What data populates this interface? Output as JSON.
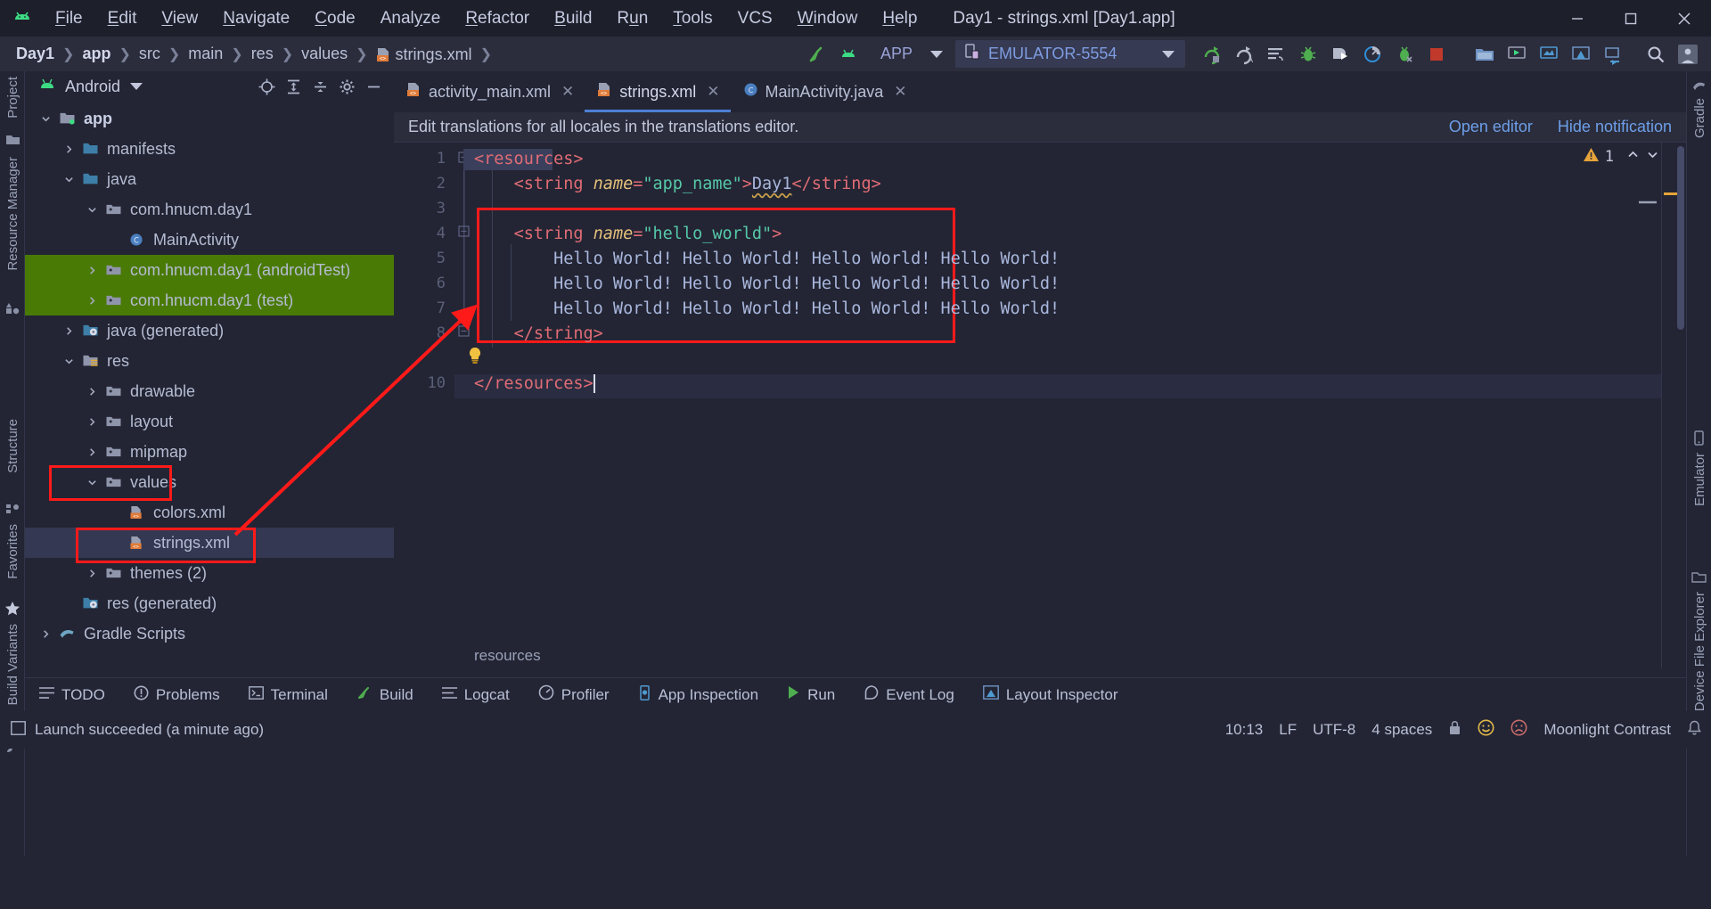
{
  "window": {
    "title": "Day1 - strings.xml [Day1.app]",
    "app_icon": "android-logo-icon",
    "minimize": "minimize-icon",
    "maximize": "maximize-icon",
    "close": "close-icon"
  },
  "menu": [
    {
      "label": "File",
      "mnemonic": "F"
    },
    {
      "label": "Edit",
      "mnemonic": "E"
    },
    {
      "label": "View",
      "mnemonic": "V"
    },
    {
      "label": "Navigate",
      "mnemonic": "N"
    },
    {
      "label": "Code",
      "mnemonic": "C"
    },
    {
      "label": "Analyze",
      "mnemonic": "y"
    },
    {
      "label": "Refactor",
      "mnemonic": "R"
    },
    {
      "label": "Build",
      "mnemonic": "B"
    },
    {
      "label": "Run",
      "mnemonic": "u"
    },
    {
      "label": "Tools",
      "mnemonic": "T"
    },
    {
      "label": "VCS",
      "mnemonic": ""
    },
    {
      "label": "Window",
      "mnemonic": "W"
    },
    {
      "label": "Help",
      "mnemonic": "H"
    }
  ],
  "breadcrumbs": [
    {
      "label": "Day1",
      "bold": true
    },
    {
      "label": "app",
      "bold": true
    },
    {
      "label": "src",
      "bold": false
    },
    {
      "label": "main",
      "bold": false
    },
    {
      "label": "res",
      "bold": false
    },
    {
      "label": "values",
      "bold": false
    },
    {
      "label": "strings.xml",
      "bold": false,
      "icon": "xml-file-icon"
    }
  ],
  "toolbar": {
    "build_icon": "build-hammer-icon",
    "avd_icon": "avd-manager-icon",
    "run_config": "APP",
    "device": "EMULATOR-5554",
    "device_icon": "device-phone-icon",
    "dropdown_icon": "chevron-down-icon",
    "actions": [
      {
        "name": "run-button",
        "icon": "run-green-arrow-icon"
      },
      {
        "name": "apply-changes-button",
        "icon": "apply-changes-icon"
      },
      {
        "name": "apply-code-changes-button",
        "icon": "apply-code-changes-icon"
      },
      {
        "name": "debug-button",
        "icon": "debug-bug-icon"
      },
      {
        "name": "attach-debugger-button",
        "icon": "attach-debugger-icon"
      },
      {
        "name": "profiler-button",
        "icon": "profiler-gauge-icon"
      },
      {
        "name": "run-with-coverage-button",
        "icon": "coverage-icon"
      },
      {
        "name": "stop-button",
        "icon": "stop-square-icon"
      },
      {
        "name": "sdk-manager-button",
        "icon": "sdk-manager-icon"
      },
      {
        "name": "avd-manager-button",
        "icon": "avd-manager-icon"
      },
      {
        "name": "device-file-explorer-button",
        "icon": "device-explorer-icon"
      },
      {
        "name": "layout-inspector-button",
        "icon": "layout-inspector-icon"
      },
      {
        "name": "sync-gradle-button",
        "icon": "sync-gradle-icon"
      },
      {
        "name": "search-everywhere-button",
        "icon": "search-icon"
      },
      {
        "name": "account-button",
        "icon": "avatar-icon"
      }
    ]
  },
  "left_stripe": [
    {
      "label": "Project",
      "icon": "project-icon"
    },
    {
      "label": "Resource Manager",
      "icon": "resource-manager-icon"
    },
    {
      "label": "Structure",
      "icon": "structure-icon"
    },
    {
      "label": "Favorites",
      "icon": "star-icon"
    },
    {
      "label": "Build Variants",
      "icon": "build-variants-icon"
    }
  ],
  "right_stripe": [
    {
      "label": "Gradle",
      "icon": "gradle-icon"
    },
    {
      "label": "Emulator",
      "icon": "emulator-icon"
    },
    {
      "label": "Device File Explorer",
      "icon": "device-file-explorer-icon"
    }
  ],
  "project_panel": {
    "view_name": "Android",
    "view_icon": "android-head-icon",
    "actions": [
      {
        "name": "select-opened-file-button",
        "icon": "target-crosshair-icon"
      },
      {
        "name": "expand-all-button",
        "icon": "expand-all-icon"
      },
      {
        "name": "collapse-all-button",
        "icon": "collapse-all-icon"
      },
      {
        "name": "settings-button",
        "icon": "gear-icon"
      },
      {
        "name": "hide-button",
        "icon": "minimize-icon"
      }
    ],
    "tree": [
      {
        "label": "app",
        "depth": 0,
        "arrow": "down",
        "icon": "module-folder-icon",
        "bold": true,
        "state": "normal"
      },
      {
        "label": "manifests",
        "depth": 1,
        "arrow": "right",
        "icon": "blue-folder-icon",
        "state": "normal"
      },
      {
        "label": "java",
        "depth": 1,
        "arrow": "down",
        "icon": "blue-folder-icon",
        "state": "normal"
      },
      {
        "label": "com.hnucm.day1",
        "depth": 2,
        "arrow": "down",
        "icon": "package-folder-icon",
        "state": "normal"
      },
      {
        "label": "MainActivity",
        "depth": 3,
        "arrow": "none",
        "icon": "java-class-icon",
        "state": "normal"
      },
      {
        "label": "com.hnucm.day1 (androidTest)",
        "depth": 2,
        "arrow": "right",
        "icon": "package-folder-icon",
        "state": "green"
      },
      {
        "label": "com.hnucm.day1 (test)",
        "depth": 2,
        "arrow": "right",
        "icon": "package-folder-icon",
        "state": "green"
      },
      {
        "label": "java (generated)",
        "depth": 1,
        "arrow": "right",
        "icon": "generated-folder-icon",
        "state": "normal"
      },
      {
        "label": "res",
        "depth": 1,
        "arrow": "down",
        "icon": "res-folder-icon",
        "state": "normal"
      },
      {
        "label": "drawable",
        "depth": 2,
        "arrow": "right",
        "icon": "package-folder-icon",
        "state": "normal"
      },
      {
        "label": "layout",
        "depth": 2,
        "arrow": "right",
        "icon": "package-folder-icon",
        "state": "normal"
      },
      {
        "label": "mipmap",
        "depth": 2,
        "arrow": "right",
        "icon": "package-folder-icon",
        "state": "normal"
      },
      {
        "label": "values",
        "depth": 2,
        "arrow": "down",
        "icon": "package-folder-icon",
        "state": "normal",
        "highlight": "red-box"
      },
      {
        "label": "colors.xml",
        "depth": 3,
        "arrow": "none",
        "icon": "xml-file-icon",
        "state": "normal"
      },
      {
        "label": "strings.xml",
        "depth": 3,
        "arrow": "none",
        "icon": "xml-file-icon",
        "state": "selected",
        "highlight": "red-box"
      },
      {
        "label": "themes (2)",
        "depth": 2,
        "arrow": "right",
        "icon": "package-folder-icon",
        "state": "normal"
      },
      {
        "label": "res (generated)",
        "depth": 1,
        "arrow": "none",
        "icon": "generated-folder-icon",
        "state": "normal"
      },
      {
        "label": "Gradle Scripts",
        "depth": 0,
        "arrow": "right",
        "icon": "gradle-scripts-icon",
        "state": "normal"
      }
    ]
  },
  "editor": {
    "tabs": [
      {
        "label": "activity_main.xml",
        "icon": "xml-file-icon",
        "active": false,
        "close": "close-icon"
      },
      {
        "label": "strings.xml",
        "icon": "xml-file-icon",
        "active": true,
        "close": "close-icon"
      },
      {
        "label": "MainActivity.java",
        "icon": "java-class-icon",
        "active": false,
        "close": "close-icon"
      }
    ],
    "notification": {
      "message": "Edit translations for all locales in the translations editor.",
      "open_editor": "Open editor",
      "hide_notification": "Hide notification"
    },
    "warning_count": "1",
    "warning_icon": "warning-triangle-icon",
    "nav_up_icon": "chevron-up-icon",
    "nav_down_icon": "chevron-down-icon",
    "bottom_breadcrumb": "resources",
    "lightbulb_icon": "intention-bulb-icon",
    "lines": [
      {
        "num": "1",
        "indent": 0,
        "tokens": [
          {
            "t": "brk",
            "v": "<"
          },
          {
            "t": "tag",
            "v": "resources"
          },
          {
            "t": "brk",
            "v": ">"
          }
        ],
        "selected": true
      },
      {
        "num": "2",
        "indent": 1,
        "tokens": [
          {
            "t": "brk",
            "v": "<"
          },
          {
            "t": "tag",
            "v": "string"
          },
          {
            "t": "plain",
            "v": " "
          },
          {
            "t": "attr",
            "v": "name"
          },
          {
            "t": "brk",
            "v": "="
          },
          {
            "t": "str",
            "v": "\"app_name\""
          },
          {
            "t": "brk",
            "v": ">"
          },
          {
            "t": "txt",
            "v": "Day1"
          },
          {
            "t": "brk",
            "v": "</"
          },
          {
            "t": "tag",
            "v": "string"
          },
          {
            "t": "brk",
            "v": ">"
          }
        ],
        "typo": "Day1"
      },
      {
        "num": "3",
        "indent": 0,
        "tokens": []
      },
      {
        "num": "4",
        "indent": 1,
        "tokens": [
          {
            "t": "brk",
            "v": "<"
          },
          {
            "t": "tag",
            "v": "string"
          },
          {
            "t": "plain",
            "v": " "
          },
          {
            "t": "attr",
            "v": "name"
          },
          {
            "t": "brk",
            "v": "="
          },
          {
            "t": "str",
            "v": "\"hello_world\""
          },
          {
            "t": "brk",
            "v": ">"
          }
        ]
      },
      {
        "num": "5",
        "indent": 2,
        "tokens": [
          {
            "t": "txt",
            "v": "Hello World! Hello World! Hello World! Hello World!"
          }
        ]
      },
      {
        "num": "6",
        "indent": 2,
        "tokens": [
          {
            "t": "txt",
            "v": "Hello World! Hello World! Hello World! Hello World!"
          }
        ]
      },
      {
        "num": "7",
        "indent": 2,
        "tokens": [
          {
            "t": "txt",
            "v": "Hello World! Hello World! Hello World! Hello World!"
          }
        ]
      },
      {
        "num": "8",
        "indent": 1,
        "tokens": [
          {
            "t": "brk",
            "v": "</"
          },
          {
            "t": "tag",
            "v": "string"
          },
          {
            "t": "brk",
            "v": ">"
          }
        ]
      },
      {
        "num": "",
        "indent": 1,
        "tokens": []
      },
      {
        "num": "10",
        "indent": 0,
        "tokens": [
          {
            "t": "brk",
            "v": "</"
          },
          {
            "t": "tag",
            "v": "resources"
          },
          {
            "t": "brk",
            "v": ">"
          }
        ],
        "caret": true,
        "current": true
      }
    ]
  },
  "bottom_toolbar": [
    {
      "label": "TODO",
      "icon": "todo-list-icon"
    },
    {
      "label": "Problems",
      "icon": "problems-icon"
    },
    {
      "label": "Terminal",
      "icon": "terminal-icon"
    },
    {
      "label": "Build",
      "icon": "build-hammer-icon"
    },
    {
      "label": "Logcat",
      "icon": "logcat-icon"
    },
    {
      "label": "Profiler",
      "icon": "profiler-gauge-icon"
    },
    {
      "label": "App Inspection",
      "icon": "app-inspection-icon"
    },
    {
      "label": "Run",
      "icon": "run-green-arrow-icon"
    }
  ],
  "bottom_toolbar_right": [
    {
      "label": "Event Log",
      "icon": "event-log-icon"
    },
    {
      "label": "Layout Inspector",
      "icon": "layout-inspector-icon"
    }
  ],
  "status_bar": {
    "message": "Launch succeeded (a minute ago)",
    "message_icon": "console-icon",
    "position": "10:13",
    "line_separator": "LF",
    "encoding": "UTF-8",
    "indent": "4 spaces",
    "lock_icon": "lock-icon",
    "feedback_happy_icon": "smiley-happy-icon",
    "feedback_sad_icon": "smiley-sad-icon",
    "theme": "Moonlight Contrast",
    "notifications_icon": "bell-icon"
  },
  "colors": {
    "bg": "#232534",
    "titlebar_bg": "#1d1f2b",
    "navbar_bg": "#2b2d3c",
    "accent_blue": "#6d9fe8",
    "green_highlight": "#4a7a06",
    "red_annotation": "#ff1a1a",
    "tab_underline": "#4c7fd4",
    "selection": "#343853"
  }
}
